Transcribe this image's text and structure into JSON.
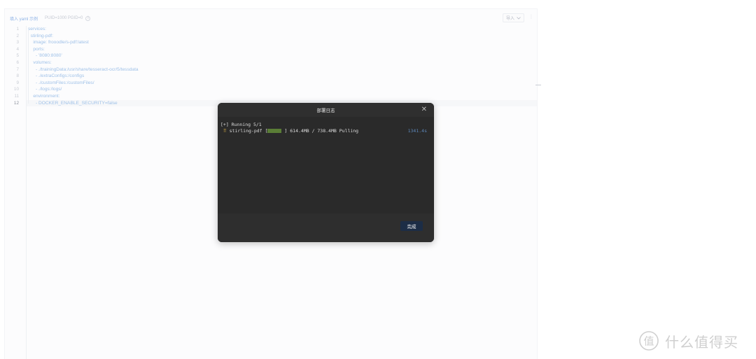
{
  "editor": {
    "header": {
      "link_label": "填入 yaml 示例",
      "hint": "PUID=1000 PGID=0",
      "info_icon": "info-icon",
      "import_label": "导入",
      "import_icon": "chevron-down-icon",
      "more_icon": "more-icon"
    },
    "lines": [
      {
        "n": "1",
        "text": "services:"
      },
      {
        "n": "2",
        "text": "  stirling-pdf:"
      },
      {
        "n": "3",
        "text": "    image: frooodle/s-pdf:latest"
      },
      {
        "n": "4",
        "text": "    ports:"
      },
      {
        "n": "5",
        "text": "      - '8080:8080'"
      },
      {
        "n": "6",
        "text": "    volumes:"
      },
      {
        "n": "7",
        "text": "      - ./trainingData:/usr/share/tesseract-ocr/5/tessdata"
      },
      {
        "n": "8",
        "text": "      - ./extraConfigs:/configs"
      },
      {
        "n": "9",
        "text": "      - ./customFiles:/customFiles/"
      },
      {
        "n": "10",
        "text": "      - ./logs:/logs/"
      },
      {
        "n": "11",
        "text": "    environment:"
      },
      {
        "n": "12",
        "text": "      - DOCKER_ENABLE_SECURITY=false"
      }
    ],
    "current_line_index": 11
  },
  "modal": {
    "title": "部署日志",
    "close_icon": "close-icon",
    "log": {
      "line1": "[+] Running 5/1",
      "spinner": "⠿",
      "service": "stirling-pdf",
      "bracket_open": "[",
      "bracket_close": "]",
      "progress_fraction": 0.83,
      "progress_text": "614.4MB / 738.4MB Pulling",
      "elapsed": "1341.4s"
    },
    "done_label": "完成"
  },
  "watermark": {
    "text": "什么值得买",
    "logo_icon": "smzdm-logo-icon",
    "logo_glyph": "值"
  },
  "colors": {
    "modal_bg": "#2b2b2b",
    "done_button": "#1c2d46",
    "code_text": "#9fc1e8",
    "progress_fill": "#5a7d36"
  }
}
